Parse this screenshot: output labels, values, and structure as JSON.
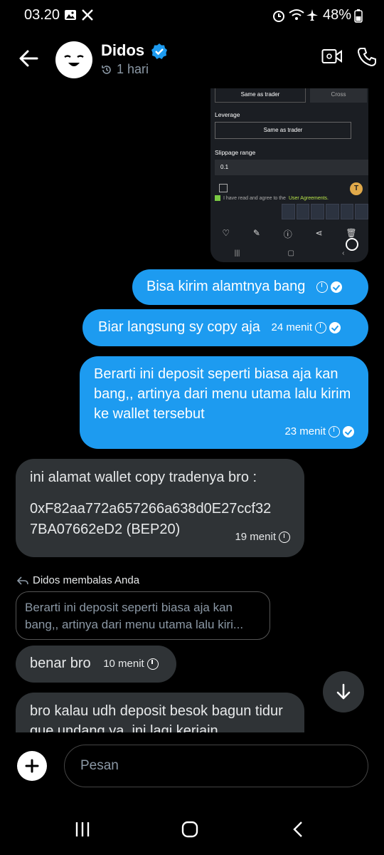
{
  "status_bar": {
    "time": "03.20",
    "battery": "48%",
    "icons": [
      "gallery-icon",
      "x-logo-icon",
      "alarm-icon",
      "wifi-call-icon",
      "airplane-icon",
      "battery-icon"
    ]
  },
  "header": {
    "contact_name": "Didos",
    "verified": true,
    "last_seen": "1 hari",
    "icons": [
      "back-arrow-icon",
      "video-call-icon",
      "phone-icon"
    ]
  },
  "shared_screenshot": {
    "option_1": "Same as trader",
    "option_1b": "Cross",
    "leverage_label": "Leverage",
    "leverage_value": "Same as trader",
    "slippage_label": "Slippage range",
    "slippage_value": "0.1",
    "agree_text": "I have read and agree to the",
    "agree_link": "User Agreements."
  },
  "messages": [
    {
      "direction": "out",
      "text": "Bisa kirim alamtnya bang",
      "time": ""
    },
    {
      "direction": "out",
      "text": "Biar langsung sy copy aja",
      "time": "24 menit"
    },
    {
      "direction": "out",
      "text": "Berarti ini deposit seperti biasa aja kan bang,, artinya dari menu utama lalu kirim ke wallet tersebut",
      "time": "23 menit"
    },
    {
      "direction": "in",
      "text_line1": "ini alamat wallet copy tradenya bro :",
      "text_line2": "0xF82aa772a657266a638d0E27ccf327BA07662eD2 (BEP20)",
      "time": "19 menit"
    },
    {
      "direction": "in",
      "reply_label": "Didos membalas Anda",
      "quoted": "Berarti ini deposit seperti biasa aja kan bang,, artinya dari menu utama lalu kiri...",
      "text": "benar bro",
      "time": "10 menit"
    },
    {
      "direction": "in",
      "text": "bro kalau udh deposit besok bagun tidur gue undang ya, ini lagi kerjain"
    }
  ],
  "composer": {
    "placeholder": "Pesan"
  },
  "colors": {
    "background": "#000000",
    "outgoing_bubble": "#1d9bf0",
    "incoming_bubble": "#2f3336",
    "secondary_text": "#8b98a5"
  }
}
